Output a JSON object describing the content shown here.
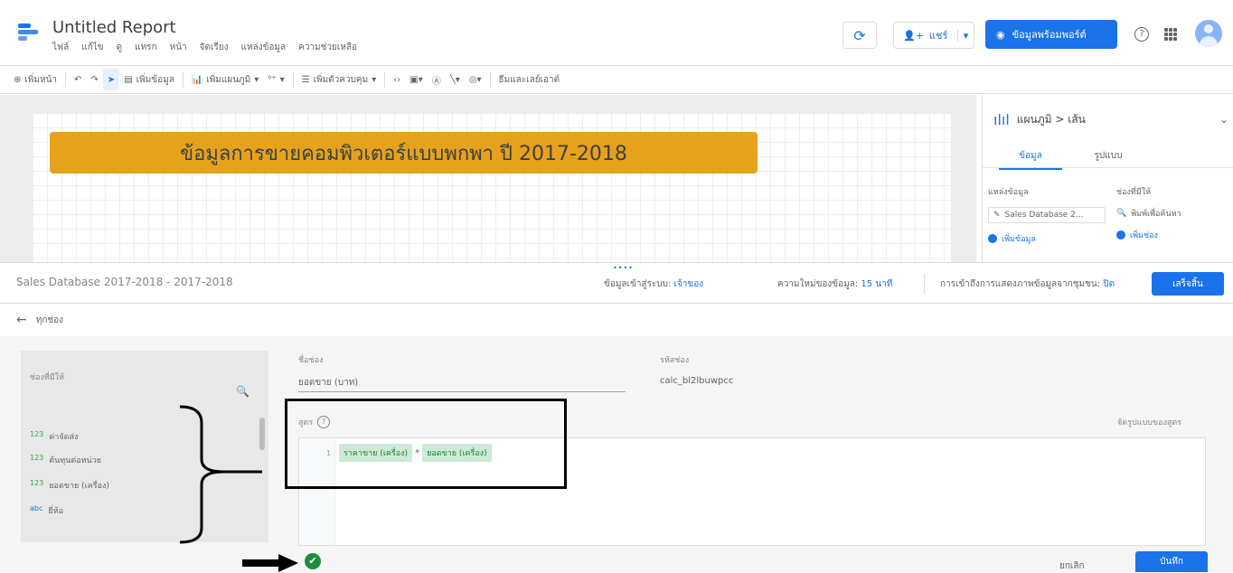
{
  "header": {
    "title": "Untitled Report",
    "menu": [
      "ไฟล์",
      "แก้ไข",
      "ดู",
      "แทรก",
      "หน้า",
      "จัดเรียง",
      "แหล่งข้อมูล",
      "ความช่วยเหลือ"
    ],
    "share_label": "แชร์",
    "view_label": "ข้อมูลพร้อมพอร์ต์"
  },
  "toolbar": {
    "add_page": "เพิ่มหน้า",
    "add_data": "เพิ่มข้อมูล",
    "add_chart": "เพิ่มแผนภูมิ",
    "add_control": "เพิ่มตัวควบคุม",
    "theme": "ธีมและเลย์เอาต์"
  },
  "canvas": {
    "banner_text": "ข้อมูลการขายคอมพิวเตอร์แบบพกพา ปี 2017-2018"
  },
  "right_panel": {
    "breadcrumb": "แผนภูมิ > เส้น",
    "tab_data": "ข้อมูล",
    "tab_style": "รูปแบบ",
    "source_header": "แหล่งข้อมูล",
    "source_value": "Sales Database 2...",
    "fields_header": "ช่องที่มีให้",
    "search_placeholder": "พิมพ์เพื่อค้นหา",
    "add_field": "เพิ่มช่อง"
  },
  "editor": {
    "datasource_name": "Sales Database 2017-2018 - 2017-2018",
    "credentials_label": "ข้อมูลเข้าสู่ระบบ:",
    "credentials_value": "เจ้าของ",
    "freshness_label": "ความใหม่ของข้อมูล:",
    "freshness_value": "15 นาที",
    "access_label": "การเข้าถึงการแสดงภาพข้อมูลจากชุมชน:",
    "access_value": "ปิด",
    "done_label": "เสร็จสิ้น",
    "back_label": "ทุกช่อง"
  },
  "fields_panel": {
    "header": "ช่องที่มีให้",
    "items": [
      {
        "type": "123",
        "name": "ค่าจัดส่ง"
      },
      {
        "type": "123",
        "name": "ต้นทุนต่อหน่วย"
      },
      {
        "type": "123",
        "name": "ยอดขาย (เครื่อง)"
      },
      {
        "type": "abc",
        "name": "ยี่ห้อ"
      }
    ]
  },
  "form": {
    "field_name_label": "ชื่อช่อง",
    "field_name_value": "ยอดขาย (บาท)",
    "field_id_label": "รหัสช่อง",
    "field_id_value": "calc_bl2lbuwpcc",
    "formula_label": "สูตร",
    "formula_format": "จัดรูปแบบของสูตร",
    "line_number": "1",
    "formula_tokens": [
      "ราคาขาย (เครื่อง)",
      "*",
      "ยอดขาย (เครื่อง)"
    ]
  },
  "footer": {
    "cancel_label": "ยกเลิก",
    "save_label": "บันทึก"
  },
  "colors": {
    "accent": "#1a73e8",
    "banner": "#e6a21b",
    "valid": "#1e8e3e",
    "chip": "#ceead6"
  },
  "icons": [
    "logo-icon",
    "refresh-icon",
    "add-person-icon",
    "eye-icon",
    "help-icon",
    "apps-icon",
    "avatar",
    "search-icon",
    "back-arrow-icon",
    "check-circle-icon"
  ]
}
